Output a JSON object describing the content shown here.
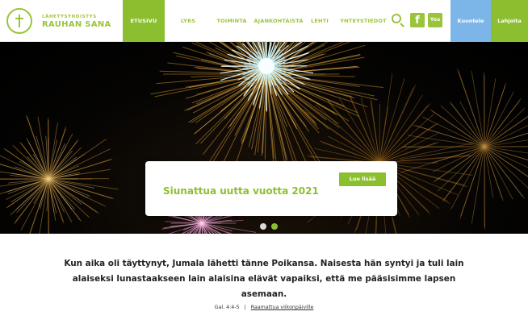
{
  "brand": {
    "logo_small": "LÄHETYSYHDISTYS",
    "logo_big": "RAUHAN SANA"
  },
  "nav": {
    "items": [
      {
        "label": "ETUSIVU",
        "active": true
      },
      {
        "label": "LYRS",
        "active": false
      },
      {
        "label": "TOIMINTA",
        "active": false
      },
      {
        "label": "AJANKOHTAISTA",
        "active": false
      },
      {
        "label": "LEHTI",
        "active": false
      },
      {
        "label": "YHTEYSTIEDOT",
        "active": false
      }
    ],
    "icons": [
      "search-icon",
      "facebook-icon",
      "youtube-icon"
    ],
    "youtube_text": "You",
    "facebook_text": "f",
    "listen_label": "Kuuntele",
    "donate_label": "Lahjoita"
  },
  "hero": {
    "title": "Siunattua uutta vuotta 2021",
    "button_label": "Lue lisää",
    "slides_total": 2,
    "slide_active": 2
  },
  "verse": {
    "text": "Kun aika oli täyttynyt, Jumala lähetti tänne Poikansa. Naisesta hän syntyi ja tuli lain alaiseksi lunastaakseen lain alaisina elävät vapaiksi, että me pääsisimme lapsen asemaan.",
    "reference": "Gal. 4:4-5",
    "separator": "|",
    "link_label": "Raamattua viikonpäiville"
  },
  "colors": {
    "brand_green": "#8cbf30",
    "listen_blue": "#7cb5e8",
    "text_dark": "#222222"
  }
}
